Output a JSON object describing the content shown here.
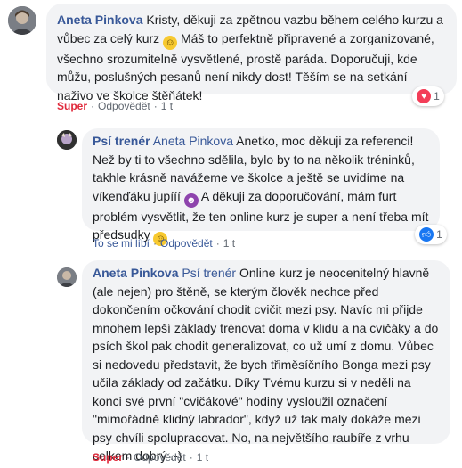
{
  "comments": [
    {
      "author": "Aneta Pinkova",
      "mention": "",
      "text_1": "Kristy, děkuji za zpětnou vazbu během celého kurzu a vůbec za celý kurz",
      "text_2": "Máš to perfektně připravené a zorganizované, všechno srozumitelně vysvětlené, prostě paráda. Doporučuji, kde můžu, poslušných pesanů není nikdy dost! Těším se na setkání naživo ve školce štěňátek!",
      "actions": {
        "like": "Super",
        "reply": "Odpovědět",
        "time": "1 t"
      },
      "reaction": {
        "icon": "heart-icon",
        "count": "1",
        "color": "#f33e58"
      }
    },
    {
      "author": "Psí trenér",
      "mention": "Aneta Pinkova",
      "text_1": "Anetko, moc děkuji za referenci! Než by ti to všechno sdělila, bylo by to na několik tréninků, takhle krásně navážeme ve školce a ještě se uvidíme na víkenďáku jupííí",
      "text_2": "A děkuji za doporučování, mám furt problém vysvětlit, že ten online kurz je super a není třeba mít předsudky",
      "actions": {
        "like": "To se mi líbí",
        "reply": "Odpovědět",
        "time": "1 t"
      },
      "reaction": {
        "icon": "like-icon",
        "count": "1",
        "color": "#1877f2"
      }
    },
    {
      "author": "Aneta Pinkova",
      "mention": "Psí trenér",
      "text_1": "Online kurz je neocenitelný hlavně (ale nejen) pro štěně, se kterým člověk nechce před dokončením očkování chodit cvičit mezi psy. Navíc mi přijde mnohem lepší základy trénovat doma v klidu a na cvičáky a do psích škol pak chodit generalizovat, co už umí z domu. Vůbec si nedovedu představit, že bych třiměsíčního Bonga mezi psy učila základy od začátku. Díky Tvému kurzu si v neděli na konci své první \"cvičákové\" hodiny vysloužil označení \"mimořádně klidný labrador\", když už tak malý dokáže mezi psy chvíli spolupracovat. No, na největšího raubíře z vrhu celkem dobrý .-)",
      "text_2": "",
      "actions": {
        "like": "Super",
        "reply": "Odpovědět",
        "time": "1 t"
      }
    }
  ]
}
